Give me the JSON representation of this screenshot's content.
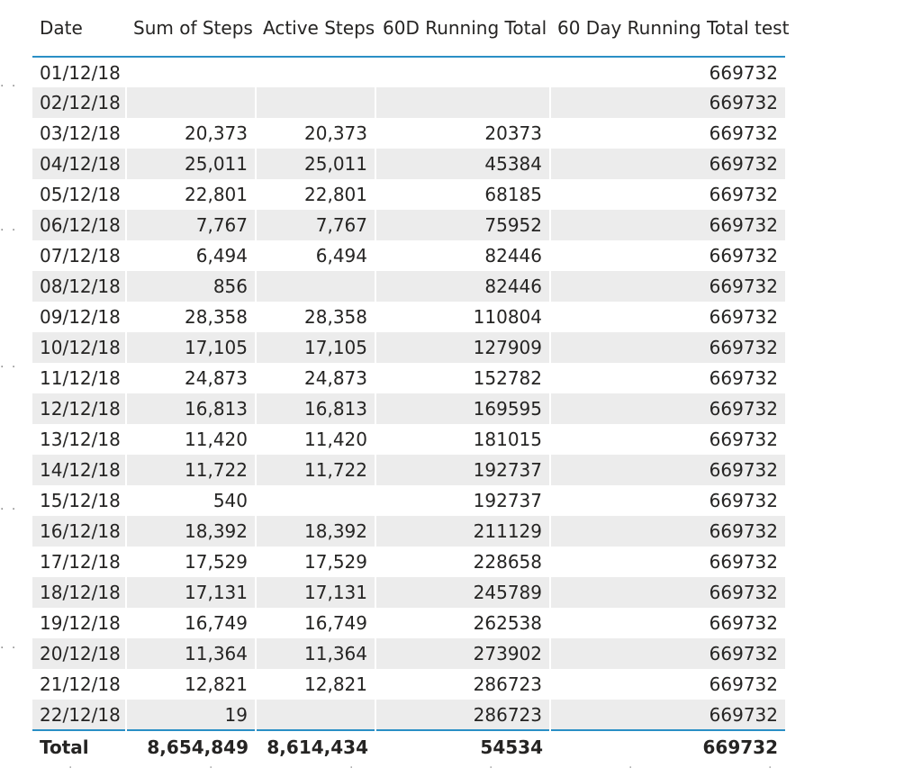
{
  "table": {
    "columns": [
      "Date",
      "Sum of Steps",
      "Active Steps",
      "60D Running Total",
      "60 Day Running Total test"
    ],
    "rows": [
      [
        "01/12/18",
        "",
        "",
        "",
        "669732"
      ],
      [
        "02/12/18",
        "",
        "",
        "",
        "669732"
      ],
      [
        "03/12/18",
        "20,373",
        "20,373",
        "20373",
        "669732"
      ],
      [
        "04/12/18",
        "25,011",
        "25,011",
        "45384",
        "669732"
      ],
      [
        "05/12/18",
        "22,801",
        "22,801",
        "68185",
        "669732"
      ],
      [
        "06/12/18",
        "7,767",
        "7,767",
        "75952",
        "669732"
      ],
      [
        "07/12/18",
        "6,494",
        "6,494",
        "82446",
        "669732"
      ],
      [
        "08/12/18",
        "856",
        "",
        "82446",
        "669732"
      ],
      [
        "09/12/18",
        "28,358",
        "28,358",
        "110804",
        "669732"
      ],
      [
        "10/12/18",
        "17,105",
        "17,105",
        "127909",
        "669732"
      ],
      [
        "11/12/18",
        "24,873",
        "24,873",
        "152782",
        "669732"
      ],
      [
        "12/12/18",
        "16,813",
        "16,813",
        "169595",
        "669732"
      ],
      [
        "13/12/18",
        "11,420",
        "11,420",
        "181015",
        "669732"
      ],
      [
        "14/12/18",
        "11,722",
        "11,722",
        "192737",
        "669732"
      ],
      [
        "15/12/18",
        "540",
        "",
        "192737",
        "669732"
      ],
      [
        "16/12/18",
        "18,392",
        "18,392",
        "211129",
        "669732"
      ],
      [
        "17/12/18",
        "17,529",
        "17,529",
        "228658",
        "669732"
      ],
      [
        "18/12/18",
        "17,131",
        "17,131",
        "245789",
        "669732"
      ],
      [
        "19/12/18",
        "16,749",
        "16,749",
        "262538",
        "669732"
      ],
      [
        "20/12/18",
        "11,364",
        "11,364",
        "273902",
        "669732"
      ],
      [
        "21/12/18",
        "12,821",
        "12,821",
        "286723",
        "669732"
      ],
      [
        "22/12/18",
        "19",
        "",
        "286723",
        "669732"
      ]
    ],
    "total": [
      "Total",
      "8,654,849",
      "8,614,434",
      "54534",
      "669732"
    ]
  },
  "colors": {
    "header_rule": "#2a8fc5",
    "alt_row": "#ececec",
    "text": "#252423"
  }
}
